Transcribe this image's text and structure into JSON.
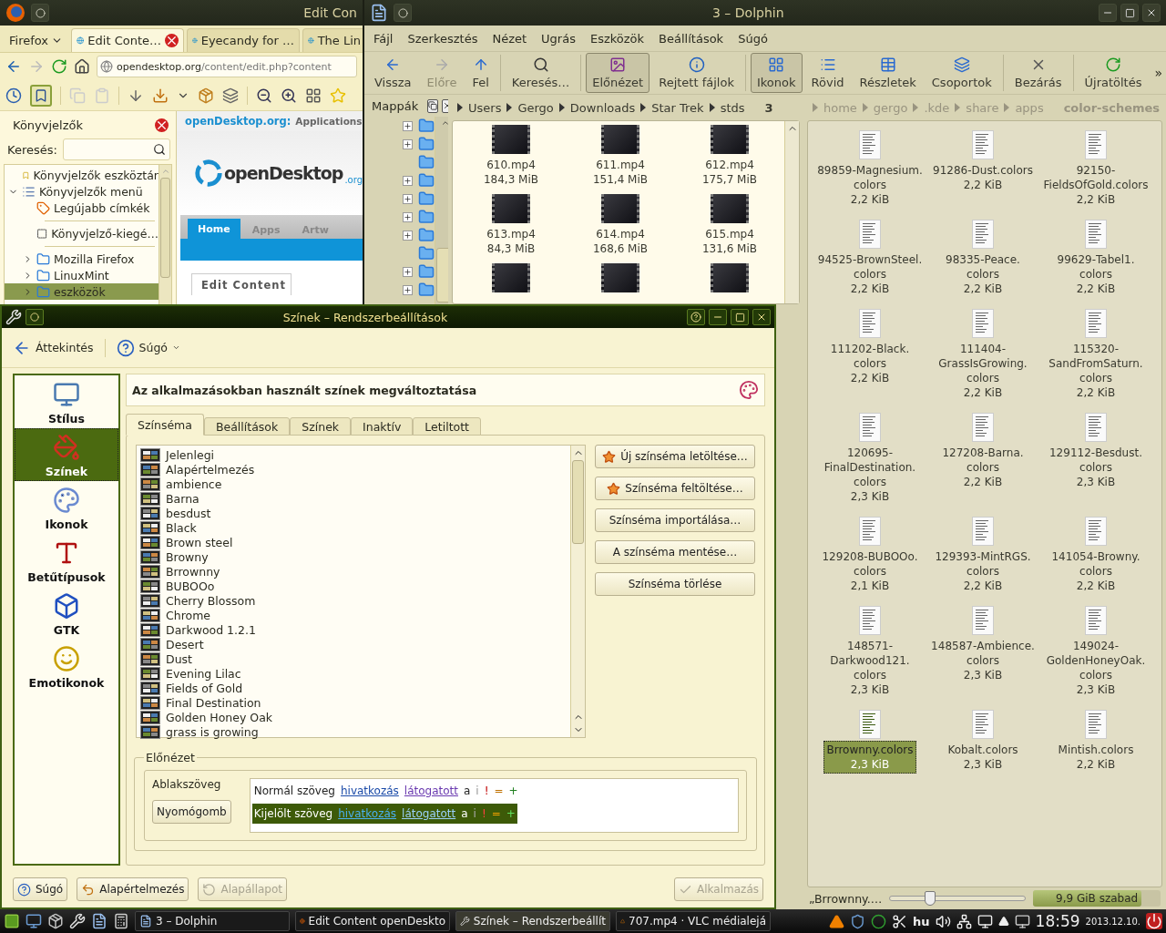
{
  "firefox": {
    "title": "Edit  Con",
    "menu_button": "Firefox",
    "tabs": [
      {
        "label": "Edit  Conte…",
        "selected": true
      },
      {
        "label": "Eyecandy for …",
        "selected": false
      },
      {
        "label": "The Lin",
        "selected": false
      }
    ],
    "url_host": "opendesktop.org",
    "url_path": "/content/edit.php?content",
    "sidebar": {
      "title": "Könyvjelzők",
      "search_label": "Keresés:",
      "items": [
        {
          "kind": "toolbar",
          "label": "Könyvjelzők eszköztár",
          "selected": false
        },
        {
          "kind": "menu",
          "label": "Könyvjelzők menü",
          "expanded": true,
          "selected": false,
          "children": [
            {
              "kind": "tags",
              "label": "Legújabb címkék",
              "selected": false
            },
            {
              "kind": "separator"
            },
            {
              "kind": "unsorted",
              "label": "Könyvjelző-kiegé…",
              "selected": false
            },
            {
              "kind": "separator"
            },
            {
              "kind": "folder",
              "label": "Mozilla Firefox",
              "expanded": false,
              "selected": false
            },
            {
              "kind": "folder",
              "label": "LinuxMint",
              "expanded": false,
              "selected": false
            },
            {
              "kind": "folder",
              "label": "eszközök",
              "expanded": false,
              "selected": true
            }
          ]
        }
      ]
    },
    "page": {
      "site": "openDesktop.org:",
      "section": "Applications",
      "logo": "openDesktop",
      "logo_suffix": ".org",
      "nav": [
        {
          "label": "Home",
          "selected": true
        },
        {
          "label": "Apps",
          "selected": false
        },
        {
          "label": "Artw",
          "selected": false
        }
      ],
      "content_tab": "Edit  Content"
    }
  },
  "dolphin": {
    "title": "3 – Dolphin",
    "menu": [
      "Fájl",
      "Szerkesztés",
      "Nézet",
      "Ugrás",
      "Eszközök",
      "Beállítások",
      "Súgó"
    ],
    "toolbar": [
      {
        "kind": "back",
        "label": "Vissza",
        "disabled": false,
        "checked": false,
        "separator_after": false
      },
      {
        "kind": "forward",
        "label": "Előre",
        "disabled": true,
        "checked": false,
        "separator_after": false
      },
      {
        "kind": "up",
        "label": "Fel",
        "disabled": false,
        "checked": false,
        "separator_after": true
      },
      {
        "kind": "search",
        "label": "Keresés…",
        "disabled": false,
        "checked": false,
        "separator_after": true
      },
      {
        "kind": "preview",
        "label": "Előnézet",
        "disabled": false,
        "checked": true,
        "separator_after": false
      },
      {
        "kind": "hidden",
        "label": "Rejtett fájlok",
        "disabled": false,
        "checked": false,
        "separator_after": true
      },
      {
        "kind": "icons",
        "label": "Ikonok",
        "disabled": false,
        "checked": true,
        "separator_after": false
      },
      {
        "kind": "compact",
        "label": "Rövid",
        "disabled": false,
        "checked": false,
        "separator_after": false
      },
      {
        "kind": "details",
        "label": "Részletek",
        "disabled": false,
        "checked": false,
        "separator_after": false
      },
      {
        "kind": "groups",
        "label": "Csoportok",
        "disabled": false,
        "checked": false,
        "separator_after": true
      },
      {
        "kind": "close",
        "label": "Bezárás",
        "disabled": false,
        "checked": false,
        "separator_after": true
      },
      {
        "kind": "reload",
        "label": "Újratöltés",
        "disabled": false,
        "checked": false,
        "separator_after": false
      }
    ],
    "overflow": "»",
    "places_title": "Mappák",
    "folder_tree": [
      {
        "expandable": true,
        "expanded": false
      },
      {
        "expandable": true,
        "expanded": false
      },
      {
        "expandable": false
      },
      {
        "expandable": true,
        "expanded": false
      },
      {
        "expandable": true,
        "expanded": false
      },
      {
        "expandable": true,
        "expanded": false
      },
      {
        "expandable": true,
        "expanded": false
      },
      {
        "expandable": false
      },
      {
        "expandable": true,
        "expanded": false
      },
      {
        "expandable": true,
        "expanded": false
      }
    ],
    "panes": [
      {
        "active": true,
        "path": [
          "Users",
          "Gergo",
          "Downloads",
          "Star Trek",
          "stds",
          "3"
        ],
        "files": [
          {
            "kind": "video",
            "name": "610.mp4",
            "size": "184,3 MiB",
            "selected": false
          },
          {
            "kind": "video",
            "name": "611.mp4",
            "size": "151,4 MiB",
            "selected": false
          },
          {
            "kind": "video",
            "name": "612.mp4",
            "size": "175,7 MiB",
            "selected": false
          },
          {
            "kind": "video",
            "name": "613.mp4",
            "size": "84,3 MiB",
            "selected": false
          },
          {
            "kind": "video",
            "name": "614.mp4",
            "size": "168,6 MiB",
            "selected": false
          },
          {
            "kind": "video",
            "name": "615.mp4",
            "size": "131,6 MiB",
            "selected": false
          },
          {
            "kind": "video"
          },
          {
            "kind": "video"
          },
          {
            "kind": "video"
          }
        ]
      },
      {
        "active": false,
        "path": [
          "home",
          "gergo",
          ".kde",
          "share",
          "apps",
          "color-schemes"
        ],
        "files": [
          {
            "kind": "text",
            "name": "89859-Magnesium.colors",
            "size": "2,2 KiB",
            "selected": false
          },
          {
            "kind": "text",
            "name": "91286-Dust.colors",
            "size": "2,2 KiB",
            "selected": false
          },
          {
            "kind": "text",
            "name": "92150-FieldsOfGold.colors",
            "size": "2,2 KiB",
            "selected": false
          },
          {
            "kind": "text",
            "name": "94525-BrownSteel.colors",
            "size": "2,2 KiB",
            "selected": false
          },
          {
            "kind": "text",
            "name": "98335-Peace.colors",
            "size": "2,2 KiB",
            "selected": false
          },
          {
            "kind": "text",
            "name": "99629-Tabel1.colors",
            "size": "2,2 KiB",
            "selected": false
          },
          {
            "kind": "text",
            "name": "111202-Black.colors",
            "size": "2,2 KiB",
            "selected": false
          },
          {
            "kind": "text",
            "name": "111404-GrassIsGrowing.colors",
            "size": "2,2 KiB",
            "selected": false
          },
          {
            "kind": "text",
            "name": "115320-SandFromSaturn.colors",
            "size": "2,2 KiB",
            "selected": false
          },
          {
            "kind": "text",
            "name": "120695-FinalDestination.colors",
            "size": "2,3 KiB",
            "selected": false
          },
          {
            "kind": "text",
            "name": "127208-Barna.colors",
            "size": "2,2 KiB",
            "selected": false
          },
          {
            "kind": "text",
            "name": "129112-Besdust.colors",
            "size": "2,3 KiB",
            "selected": false
          },
          {
            "kind": "text",
            "name": "129208-BUBOOo.colors",
            "size": "2,1 KiB",
            "selected": false
          },
          {
            "kind": "text",
            "name": "129393-MintRGS.colors",
            "size": "2,2 KiB",
            "selected": false
          },
          {
            "kind": "text",
            "name": "141054-Browny.colors",
            "size": "2,2 KiB",
            "selected": false
          },
          {
            "kind": "text",
            "name": "148571-Darkwood121.colors",
            "size": "2,3 KiB",
            "selected": false
          },
          {
            "kind": "text",
            "name": "148587-Ambience.colors",
            "size": "2,3 KiB",
            "selected": false
          },
          {
            "kind": "text",
            "name": "149024-GoldenHoneyOak.colors",
            "size": "2,3 KiB",
            "selected": false
          },
          {
            "kind": "text",
            "name": "Brrownny.colors",
            "size": "2,3 KiB",
            "selected": true
          },
          {
            "kind": "text",
            "name": "Kobalt.colors",
            "size": "2,3 KiB",
            "selected": false
          },
          {
            "kind": "text",
            "name": "Mintish.colors",
            "size": "2,2 KiB",
            "selected": false
          }
        ]
      }
    ],
    "status": {
      "text": "„Brrownny.…",
      "zoom": {
        "level": 0.3
      },
      "free_space": {
        "label": "9,9 GiB szabad",
        "level": 0.85
      }
    }
  },
  "settings": {
    "title": "Színek – Rendszerbeállítások",
    "back": "Áttekintés",
    "help": "Súgó",
    "modules": [
      {
        "kind": "style",
        "label": "Stílus",
        "selected": false
      },
      {
        "kind": "colors",
        "label": "Színek",
        "selected": true
      },
      {
        "kind": "icons",
        "label": "Ikonok",
        "selected": false
      },
      {
        "kind": "fonts",
        "label": "Betűtípusok",
        "selected": false
      },
      {
        "kind": "gtk",
        "label": "GTK",
        "selected": false
      },
      {
        "kind": "emoticons",
        "label": "Emotikonok",
        "selected": false
      }
    ],
    "header": "Az alkalmazásokban használt színek megváltoztatása",
    "tabs": [
      {
        "label": "Színséma",
        "selected": true
      },
      {
        "label": "Beállítások",
        "selected": false
      },
      {
        "label": "Színek",
        "selected": false
      },
      {
        "label": "Inaktív",
        "selected": false
      },
      {
        "label": "Letiltott",
        "selected": false
      }
    ],
    "schemes": [
      "Jelenlegi",
      "Alapértelmezés",
      "ambience",
      "Barna",
      "besdust",
      "Black",
      "Brown steel",
      "Browny",
      "Brrownny",
      "BUBOOo",
      "Cherry Blossom",
      "Chrome",
      "Darkwood 1.2.1",
      "Desert",
      "Dust",
      "Evening Lilac",
      "Fields of Gold",
      "Final Destination",
      "Golden Honey Oak",
      "grass is growing"
    ],
    "scheme_buttons": [
      {
        "kind": "download",
        "label": "Új színséma letöltése…"
      },
      {
        "kind": "upload",
        "label": "Színséma feltöltése…"
      },
      {
        "kind": "plain",
        "label": "Színséma importálása…"
      },
      {
        "kind": "plain",
        "label": "A színséma mentése…"
      },
      {
        "kind": "plain",
        "label": "Színséma törlése"
      }
    ],
    "preview": {
      "title": "Előnézet",
      "window_text": "Ablakszöveg",
      "button": "Nyomógomb",
      "rows": [
        {
          "kind": "normal",
          "label": "Normál szöveg",
          "link": "hivatkozás",
          "visited": "látogatott",
          "samples": [
            "a",
            "i",
            "!",
            "=",
            "+"
          ]
        },
        {
          "kind": "selected",
          "label": "Kijelölt szöveg",
          "link": "hivatkozás",
          "visited": "látogatott",
          "samples": [
            "a",
            "i",
            "!",
            "=",
            "+"
          ]
        }
      ]
    },
    "footer": [
      {
        "kind": "help",
        "label": "Súgó",
        "disabled": false
      },
      {
        "kind": "defaults",
        "label": "Alapértelmezés",
        "disabled": false
      },
      {
        "kind": "reset",
        "label": "Alapállapot",
        "disabled": true
      },
      {
        "kind": "apply",
        "label": "Alkalmazás",
        "disabled": true
      }
    ]
  },
  "taskbar": {
    "tasks": [
      {
        "kind": "dolphin",
        "label": "3 – Dolphin",
        "selected": false
      },
      {
        "kind": "firefox",
        "label": "Edit  Content openDeskto",
        "selected": false
      },
      {
        "kind": "settings",
        "label": "Színek – Rendszerbeállít",
        "selected": true
      },
      {
        "kind": "vlc",
        "label": "707.mp4 · VLC médialejá",
        "selected": false
      }
    ],
    "keyboard": "hu",
    "time": "18:59",
    "date": "2013.12.10."
  }
}
